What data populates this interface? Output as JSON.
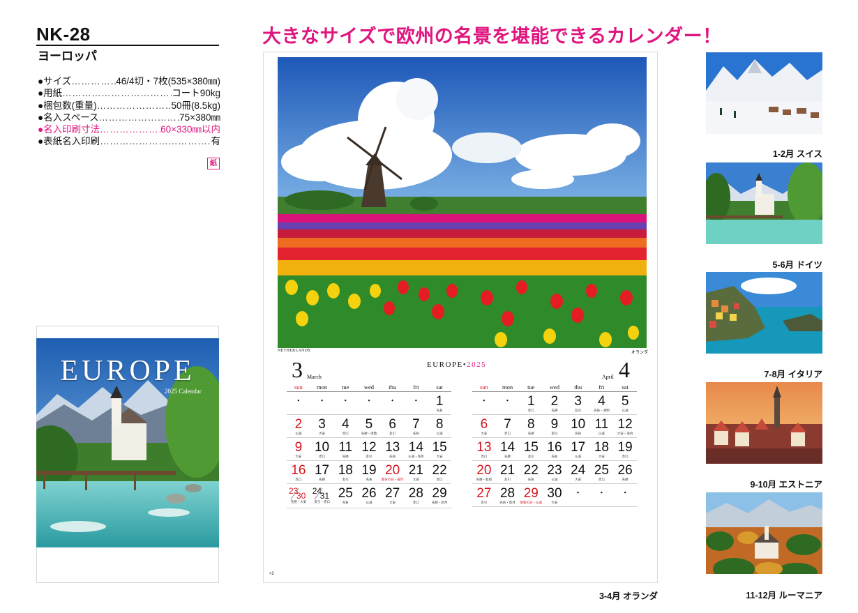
{
  "product": {
    "code": "NK-28",
    "name": "ヨーロッパ",
    "headline": "大きなサイズで欧州の名景を堪能できるカレンダー！",
    "specs": [
      {
        "label": "●サイズ",
        "dots": "……………………………",
        "value": "46/4切・7枚(535×380㎜)",
        "highlight": false
      },
      {
        "label": "●用紙",
        "dots": "…………………………………………………",
        "value": "コート90kg",
        "highlight": false
      },
      {
        "label": "●梱包数(重量)",
        "dots": "…………………………………",
        "value": "50冊(8.5kg)",
        "highlight": false
      },
      {
        "label": "●名入スペース",
        "dots": "…………………………………",
        "value": "75×380㎜",
        "highlight": false
      },
      {
        "label": "●名入印刷寸法",
        "dots": "…………………………",
        "value": "60×330㎜以内",
        "highlight": true
      },
      {
        "label": "●表紙名入印刷",
        "dots": "……………………………………………………",
        "value": "有",
        "highlight": false
      }
    ],
    "paper_icon": "紙"
  },
  "cover": {
    "title": "EUROPE",
    "subtitle": "2025 Calendar"
  },
  "sheet": {
    "photo_location_en": "NETHERLANDS",
    "photo_location_jp": "オランダ",
    "brand": "EUROPE",
    "brand_sep": "•",
    "year": "2025",
    "page_no": "×2",
    "label": "3-4月 オランダ",
    "weekdays": [
      "sun",
      "mon",
      "tue",
      "wed",
      "thu",
      "fri",
      "sat"
    ],
    "months": [
      {
        "number": "3",
        "name": "March",
        "weeks": [
          [
            {
              "d": "・"
            },
            {
              "d": "・"
            },
            {
              "d": "・"
            },
            {
              "d": "・"
            },
            {
              "d": "・"
            },
            {
              "d": "・"
            },
            {
              "d": "1",
              "s": "先負"
            }
          ],
          [
            {
              "d": "2",
              "red": true,
              "s": "仏滅"
            },
            {
              "d": "3",
              "s": "大安"
            },
            {
              "d": "4",
              "s": "赤口"
            },
            {
              "d": "5",
              "s": "先勝・啓蟄"
            },
            {
              "d": "6",
              "s": "友引"
            },
            {
              "d": "7",
              "s": "先負"
            },
            {
              "d": "8",
              "s": "仏滅"
            }
          ],
          [
            {
              "d": "9",
              "red": true,
              "s": "大安"
            },
            {
              "d": "10",
              "s": "赤口"
            },
            {
              "d": "11",
              "s": "先勝"
            },
            {
              "d": "12",
              "s": "友引"
            },
            {
              "d": "13",
              "s": "先負"
            },
            {
              "d": "14",
              "s": "仏滅・満月"
            },
            {
              "d": "15",
              "s": "大安"
            }
          ],
          [
            {
              "d": "16",
              "red": true,
              "s": "赤口"
            },
            {
              "d": "17",
              "s": "先勝"
            },
            {
              "d": "18",
              "s": "友引"
            },
            {
              "d": "19",
              "s": "先負"
            },
            {
              "d": "20",
              "red": true,
              "s": "春分の日・彼岸",
              "sred": true
            },
            {
              "d": "21",
              "s": "大安"
            },
            {
              "d": "22",
              "s": "赤口"
            }
          ],
          [
            {
              "dual": [
                "23",
                "30"
              ],
              "dsub": "先勝・大安"
            },
            {
              "dual": [
                "24",
                "31"
              ],
              "dsub": "友引・赤口",
              "dred": false
            },
            {
              "d": "25",
              "s": "先負"
            },
            {
              "d": "26",
              "s": "仏滅"
            },
            {
              "d": "27",
              "s": "大安"
            },
            {
              "d": "28",
              "s": "赤口"
            },
            {
              "d": "29",
              "s": "先勝・新月"
            }
          ]
        ]
      },
      {
        "number": "4",
        "name": "April",
        "weeks": [
          [
            {
              "d": "・"
            },
            {
              "d": "・"
            },
            {
              "d": "1",
              "s": "赤口"
            },
            {
              "d": "2",
              "s": "先勝"
            },
            {
              "d": "3",
              "s": "友引"
            },
            {
              "d": "4",
              "s": "先負・清明"
            },
            {
              "d": "5",
              "s": "仏滅"
            }
          ],
          [
            {
              "d": "6",
              "red": true,
              "s": "大安"
            },
            {
              "d": "7",
              "s": "赤口"
            },
            {
              "d": "8",
              "s": "先勝"
            },
            {
              "d": "9",
              "s": "友引"
            },
            {
              "d": "10",
              "s": "先負"
            },
            {
              "d": "11",
              "s": "仏滅"
            },
            {
              "d": "12",
              "s": "大安・満月"
            }
          ],
          [
            {
              "d": "13",
              "red": true,
              "s": "赤口"
            },
            {
              "d": "14",
              "s": "先勝"
            },
            {
              "d": "15",
              "s": "友引"
            },
            {
              "d": "16",
              "s": "先負"
            },
            {
              "d": "17",
              "s": "仏滅"
            },
            {
              "d": "18",
              "s": "大安"
            },
            {
              "d": "19",
              "s": "赤口"
            }
          ],
          [
            {
              "d": "20",
              "red": true,
              "s": "先勝・穀雨"
            },
            {
              "d": "21",
              "s": "友引"
            },
            {
              "d": "22",
              "s": "先負"
            },
            {
              "d": "23",
              "s": "仏滅"
            },
            {
              "d": "24",
              "s": "大安"
            },
            {
              "d": "25",
              "s": "赤口"
            },
            {
              "d": "26",
              "s": "先勝"
            }
          ],
          [
            {
              "d": "27",
              "red": true,
              "s": "友引"
            },
            {
              "d": "28",
              "s": "先負・新月"
            },
            {
              "d": "29",
              "red": true,
              "s": "昭和の日・仏滅",
              "sred": true
            },
            {
              "d": "30",
              "s": "大安"
            },
            {
              "d": "・"
            },
            {
              "d": "・"
            },
            {
              "d": "・"
            }
          ]
        ]
      }
    ]
  },
  "thumbnails": [
    {
      "label": "1-2月 スイス",
      "scene": "snow-alps"
    },
    {
      "label": "5-6月 ドイツ",
      "scene": "church-river"
    },
    {
      "label": "7-8月 イタリア",
      "scene": "coast-village"
    },
    {
      "label": "9-10月 エストニア",
      "scene": "old-town"
    },
    {
      "label": "11-12月 ルーマニア",
      "scene": "castle-forest"
    }
  ],
  "colors": {
    "accent": "#e0157f",
    "sunday": "#d4141d"
  }
}
